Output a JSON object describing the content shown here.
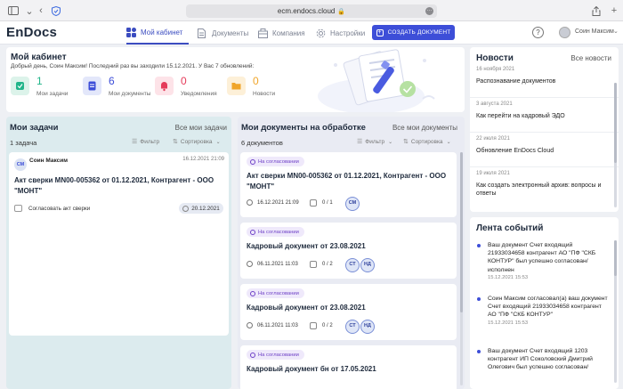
{
  "browser": {
    "url": "ecm.endocs.cloud",
    "lock_icon": "🔒"
  },
  "header": {
    "logo": "EnDocs",
    "tabs": [
      {
        "label": "Мой кабинет",
        "icon": "dashboard-icon"
      },
      {
        "label": "Документы",
        "icon": "document-icon"
      },
      {
        "label": "Компания",
        "icon": "building-icon"
      },
      {
        "label": "Настройки",
        "icon": "gear-icon"
      }
    ],
    "create_button": "СОЗДАТЬ ДОКУМЕНТ",
    "help": "?",
    "user_name": "Соин Максим"
  },
  "cabinet": {
    "title": "Мой кабинет",
    "subtitle": "Добрый день, Соин Максим! Последний раз вы заходили 15.12.2021. У Вас 7 обновлений:",
    "stats": [
      {
        "value": "1",
        "label": "Мои задачи",
        "color": "#22b58a",
        "bg": "#dcf3ea"
      },
      {
        "value": "6",
        "label": "Мои документы",
        "color": "#3d4ed8",
        "bg": "#e3e7fa"
      },
      {
        "value": "0",
        "label": "Уведомления",
        "color": "#e53b5a",
        "bg": "#fde3e8"
      },
      {
        "value": "0",
        "label": "Новости",
        "color": "#f0a52a",
        "bg": "#fdf0d8"
      }
    ]
  },
  "news": {
    "title": "Новости",
    "all": "Все новости",
    "items": [
      {
        "date": "16 ноября 2021",
        "text": "Распознавание документов"
      },
      {
        "date": "3 августа 2021",
        "text": "Как перейти на кадровый ЭДО"
      },
      {
        "date": "22 июля 2021",
        "text": "Обновление EnDocs Cloud"
      },
      {
        "date": "19 июля 2021",
        "text": "Как создать электронный архив: вопросы и ответы"
      }
    ]
  },
  "events": {
    "title": "Лента событий",
    "items": [
      {
        "text": "Ваш документ Счет входящий 21933034658 контрагент АО \"ПФ \"СКБ КОНТУР\" был успешно согласован/исполнен",
        "time": "15.12.2021 15:53"
      },
      {
        "text": "Соин Максим согласовал(а) ваш документ Счет входящий 21933034658 контрагент АО \"ПФ \"СКБ КОНТУР\"",
        "time": "15.12.2021 15:53"
      },
      {
        "text": "Ваш документ Счет входящий 1203 контрагент ИП Соколовский Дмитрий Олегович был успешно согласован/",
        "time": ""
      }
    ]
  },
  "tasks": {
    "title": "Мои задачи",
    "all": "Все мои задачи",
    "count": "1 задача",
    "filter": "Фильтр",
    "sort": "Сортировка",
    "card": {
      "initials": "СМ",
      "author": "Соин Максим",
      "datetime": "16.12.2021 21:09",
      "title": "Акт сверки МN00-005362 от 01.12.2021, Контрагент - ООО \"МОНТ\"",
      "type": "Согласовать акт сверки",
      "due": "20.12.2021"
    }
  },
  "docs": {
    "title": "Мои документы на обработке",
    "all": "Все мои документы",
    "count": "6 документов",
    "filter": "Фильтр",
    "sort": "Сортировка",
    "cards": [
      {
        "status": "На согласовании",
        "title": "Акт сверки МN00-005362 от 01.12.2021, Контрагент - ООО \"МОНТ\"",
        "datetime": "16.12.2021 21:09",
        "progress": "0 / 1",
        "chips": [
          "СМ"
        ]
      },
      {
        "status": "На согласовании",
        "title": "Кадровый документ от 23.08.2021",
        "datetime": "06.11.2021 11:03",
        "progress": "0 / 2",
        "chips": [
          "СТ",
          "НД"
        ]
      },
      {
        "status": "На согласовании",
        "title": "Кадровый документ от 23.08.2021",
        "datetime": "06.11.2021 11:03",
        "progress": "0 / 2",
        "chips": [
          "СТ",
          "НД"
        ]
      },
      {
        "status": "На согласовании",
        "title": "Кадровый документ бн от 17.05.2021",
        "datetime": "",
        "progress": "",
        "chips": []
      }
    ]
  }
}
